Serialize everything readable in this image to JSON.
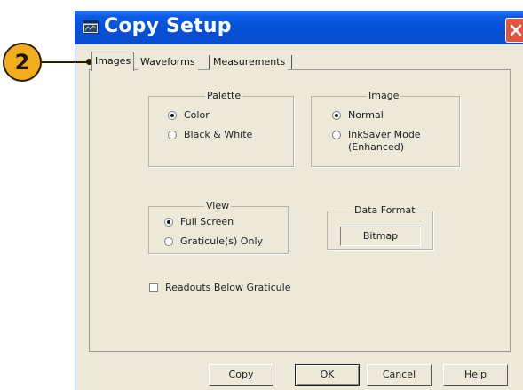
{
  "window": {
    "title": "Copy Setup",
    "title_color": "#ffffff",
    "titlebar_color": "#0450d8",
    "close_button_color": "#e0553c"
  },
  "callout": {
    "number": "2",
    "color": "#f2ad1d"
  },
  "tabs": [
    {
      "label": "Images",
      "active": true
    },
    {
      "label": "Waveforms",
      "active": false
    },
    {
      "label": "Measurements",
      "active": false
    }
  ],
  "palette": {
    "label": "Palette",
    "options": [
      {
        "label": "Color",
        "selected": true
      },
      {
        "label": "Black & White",
        "selected": false
      }
    ]
  },
  "image": {
    "label": "Image",
    "options": [
      {
        "label": "Normal",
        "selected": true
      },
      {
        "label": "InkSaver Mode",
        "label_line2": "(Enhanced)",
        "selected": false
      }
    ]
  },
  "view": {
    "label": "View",
    "options": [
      {
        "label": "Full Screen",
        "selected": true
      },
      {
        "label": "Graticule(s) Only",
        "selected": false
      }
    ]
  },
  "data_format": {
    "label": "Data Format",
    "value": "Bitmap"
  },
  "readouts": {
    "label": "Readouts Below Graticule",
    "checked": false
  },
  "buttons": {
    "copy": "Copy",
    "ok": "OK",
    "cancel": "Cancel",
    "help": "Help"
  }
}
